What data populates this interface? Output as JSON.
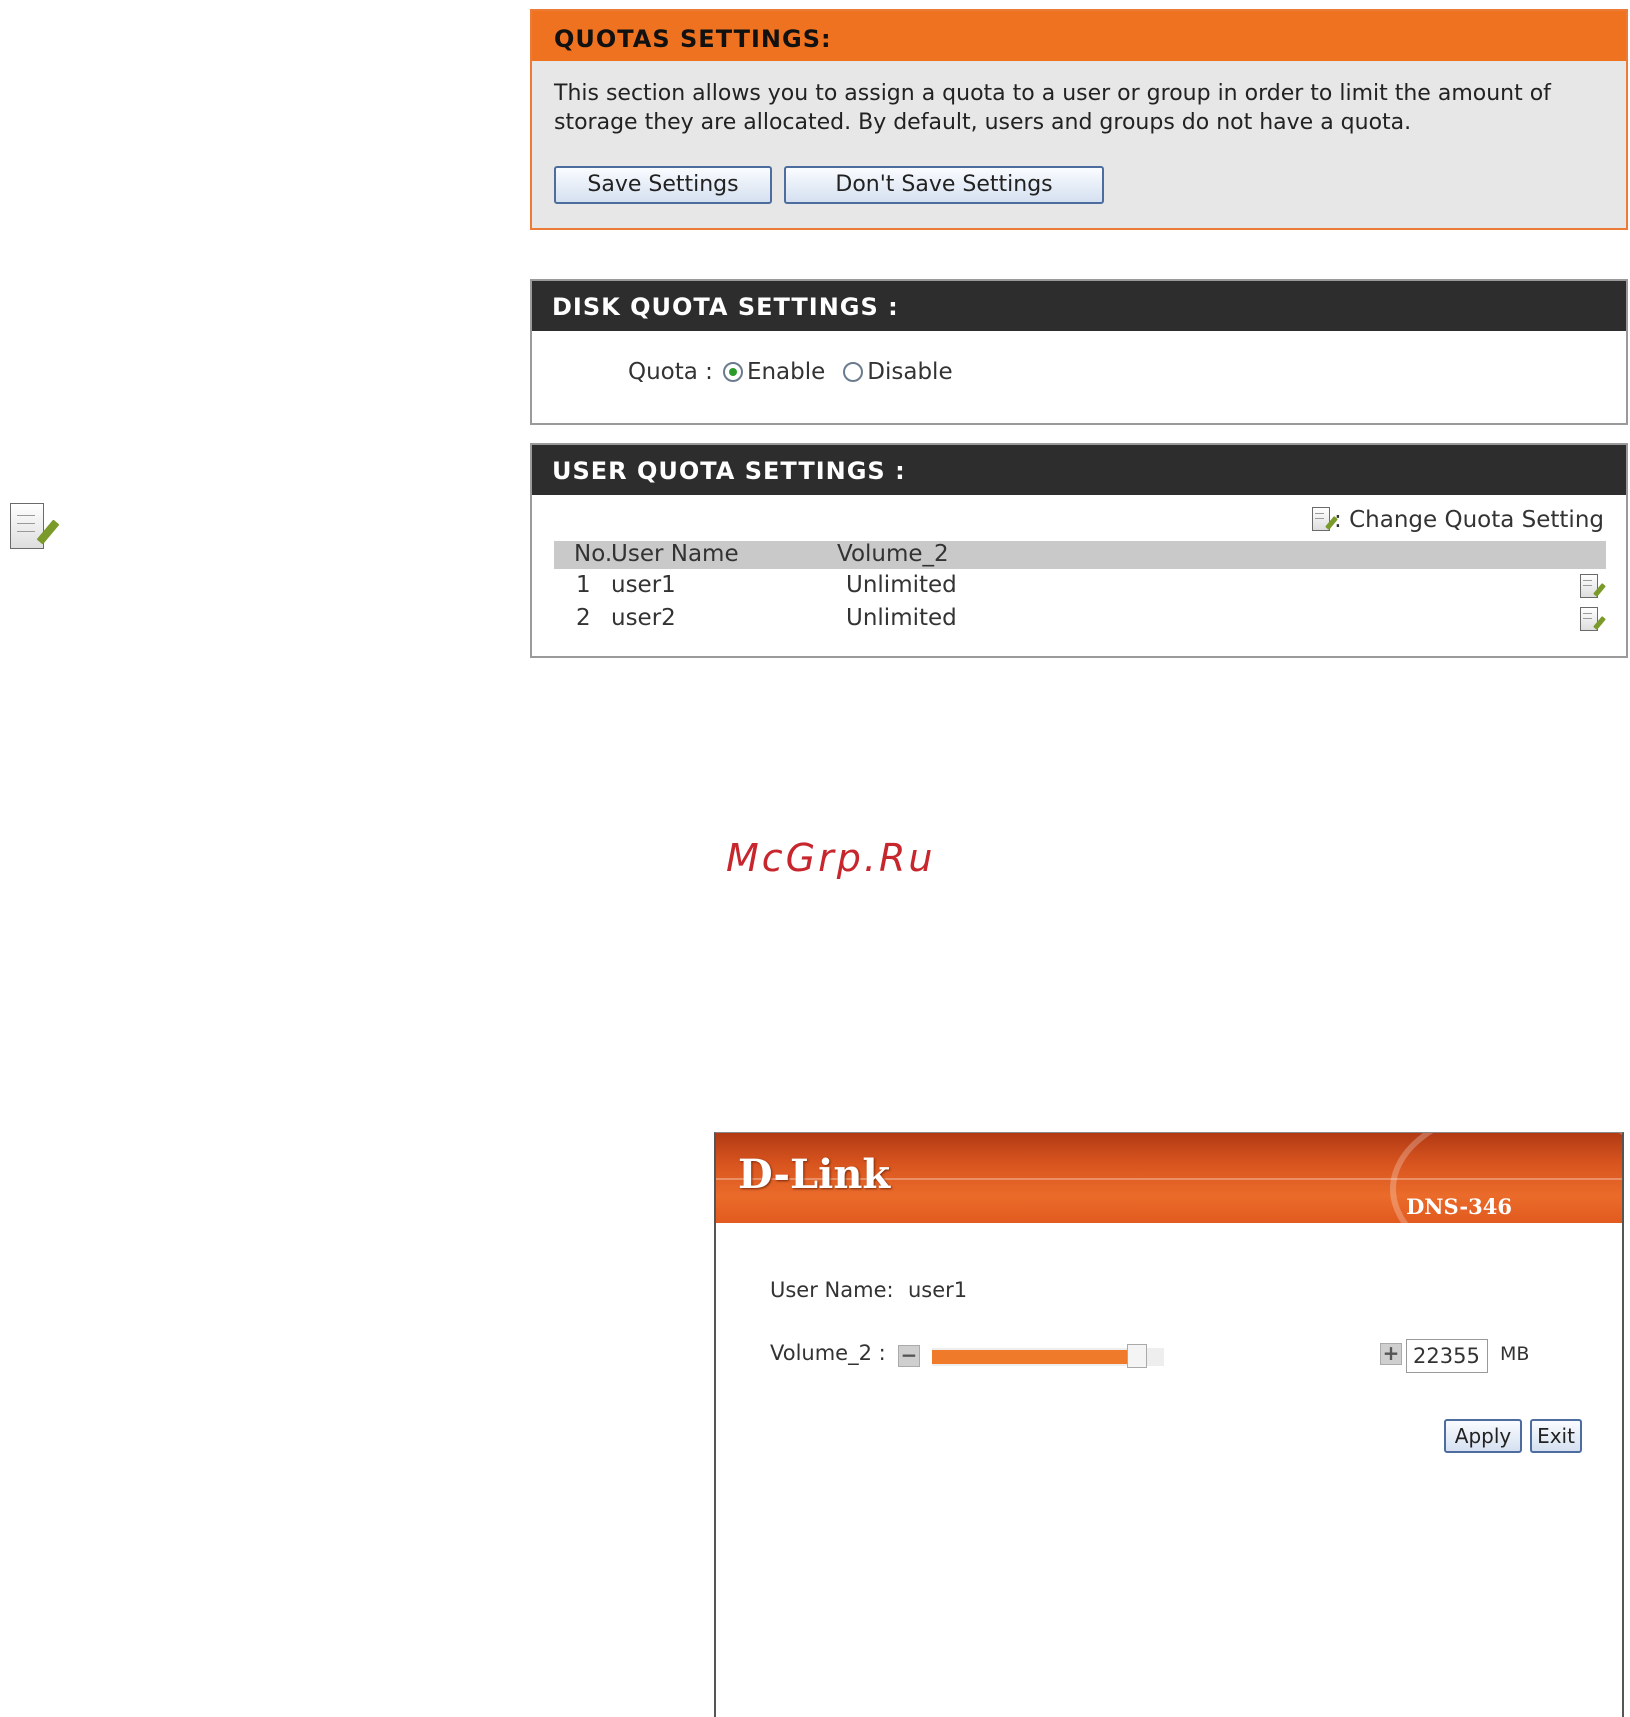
{
  "quotas": {
    "title": "QUOTAS SETTINGS:",
    "description": "This section allows you to assign a quota to a user or group in order to limit the amount of storage they are allocated. By default, users and groups do not have a quota.",
    "save_label": "Save Settings",
    "dont_save_label": "Don't Save Settings"
  },
  "disk_quota": {
    "title": "DISK QUOTA SETTINGS :",
    "label": "Quota :",
    "selected": "Enable",
    "options": [
      "Enable",
      "Disable"
    ]
  },
  "user_quota": {
    "title": "USER QUOTA SETTINGS :",
    "legend": ": Change Quota Setting",
    "columns": [
      "No.",
      "User Name",
      "Volume_2"
    ],
    "rows": [
      {
        "no": "1",
        "user": "user1",
        "volume": "Unlimited"
      },
      {
        "no": "2",
        "user": "user2",
        "volume": "Unlimited"
      }
    ]
  },
  "watermark": "McGrp.Ru",
  "popup": {
    "brand": "D-Link",
    "model": "DNS-346",
    "user_label": "User Name:",
    "user_value": "user1",
    "volume_label": "Volume_2 :",
    "minus_symbol": "−",
    "plus_symbol": "+",
    "slider_level": 0.92,
    "quota_value": "22355",
    "unit": "MB",
    "apply_label": "Apply",
    "exit_label": "Exit"
  },
  "icons": {
    "edit": "edit-note-icon",
    "brand_accent": "#ef7220",
    "dark_header": "#2d2d2d"
  }
}
